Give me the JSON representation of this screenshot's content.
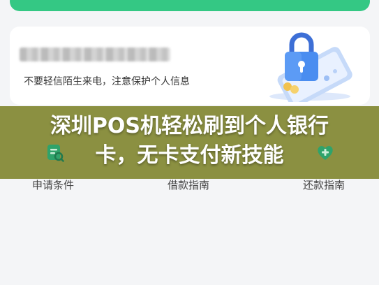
{
  "security_card": {
    "warning": "不要轻信陌生来电，注意保护个人信息"
  },
  "headline": {
    "line1": "深圳POS机轻松刷到个人银行",
    "line2": "卡，无卡支付新技能"
  },
  "menu": {
    "items": [
      {
        "label": "申请条件",
        "icon": "checklist-icon"
      },
      {
        "label": "借款指南",
        "icon": "guide-icon"
      },
      {
        "label": "还款指南",
        "icon": "repay-icon"
      }
    ]
  },
  "colors": {
    "accent_green": "#34c884",
    "overlay": "#80852c",
    "lock_blue": "#4a8df0"
  }
}
